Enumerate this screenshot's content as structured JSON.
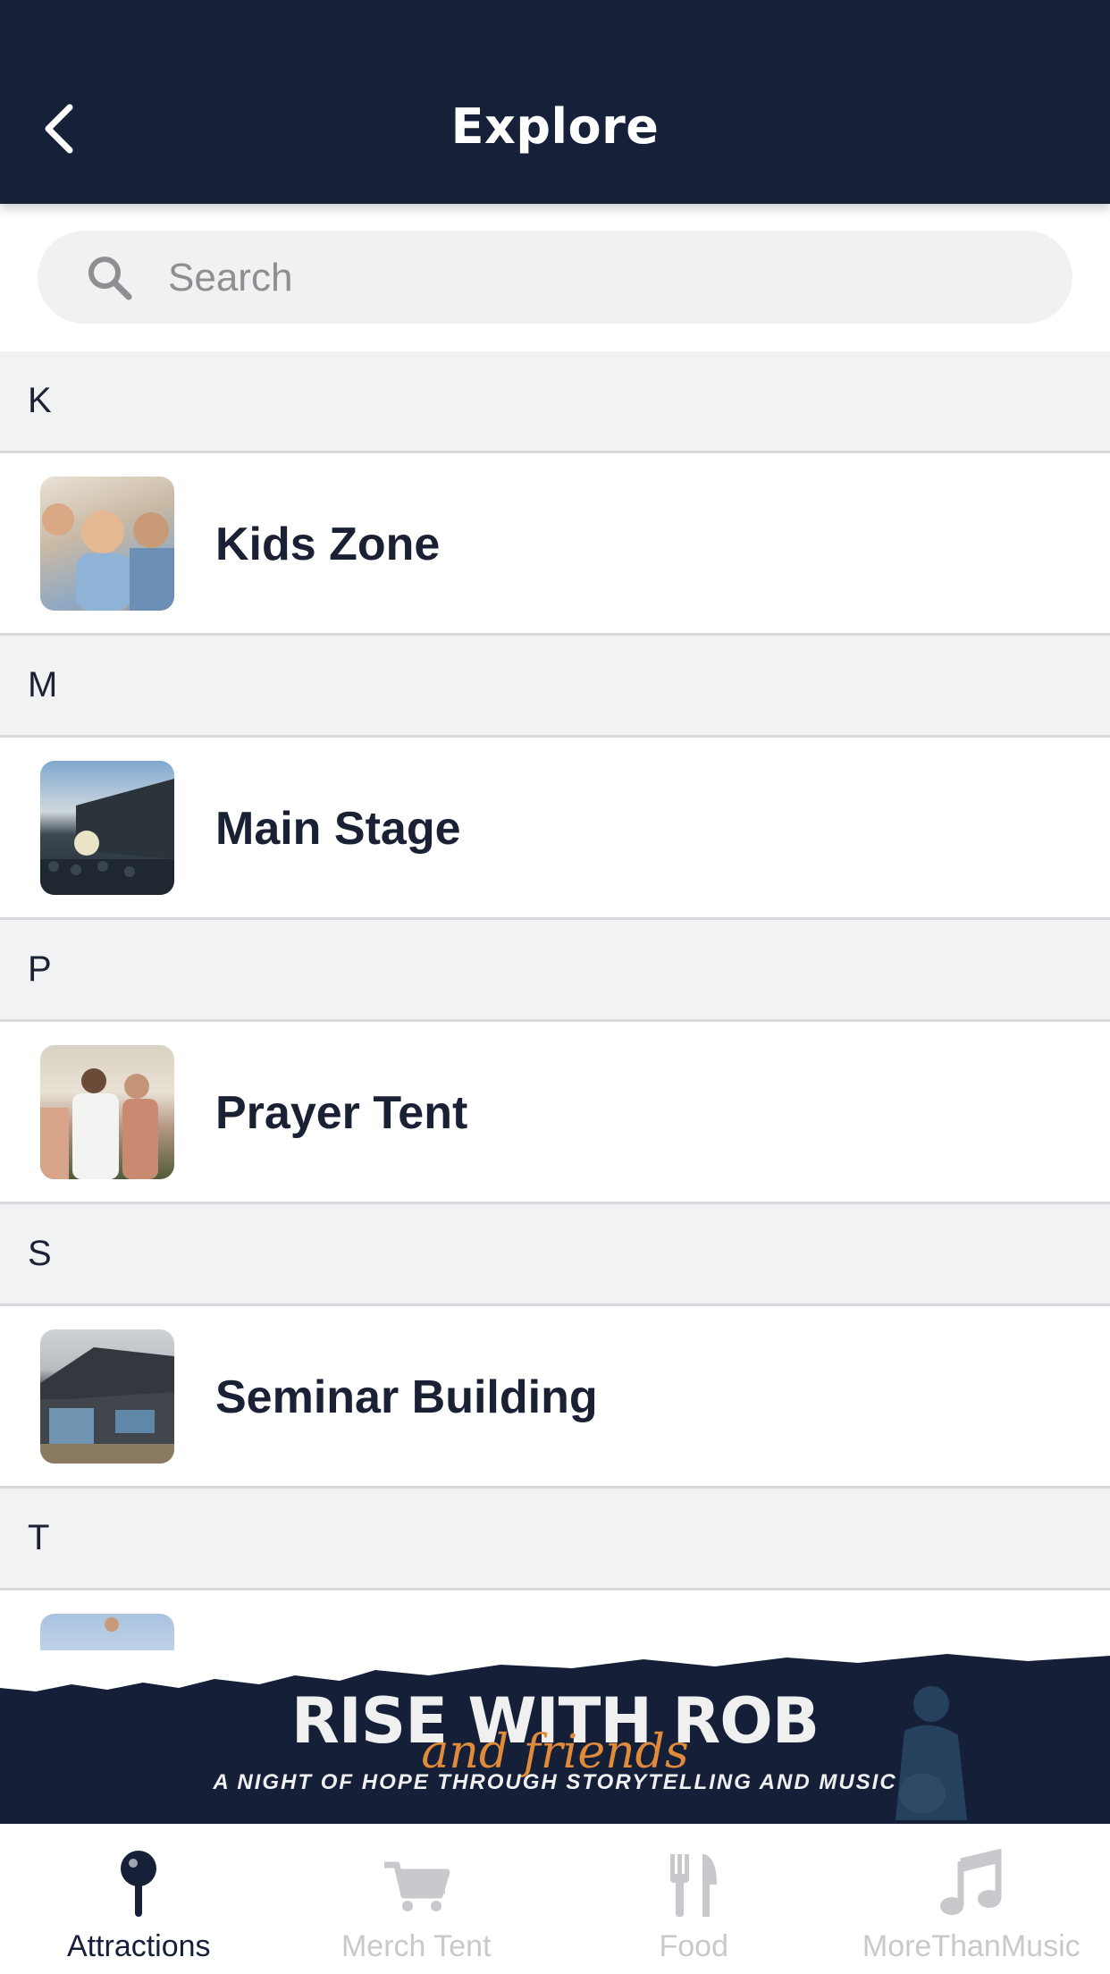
{
  "header": {
    "title": "Explore",
    "back_icon": "chevron-left-icon"
  },
  "search": {
    "placeholder": "Search",
    "icon": "search-icon"
  },
  "sections": [
    {
      "letter": "K",
      "items": [
        {
          "label": "Kids Zone"
        }
      ]
    },
    {
      "letter": "M",
      "items": [
        {
          "label": "Main Stage"
        }
      ]
    },
    {
      "letter": "P",
      "items": [
        {
          "label": "Prayer Tent"
        }
      ]
    },
    {
      "letter": "S",
      "items": [
        {
          "label": "Seminar Building"
        }
      ]
    },
    {
      "letter": "T",
      "items": [
        {
          "label": ""
        }
      ]
    }
  ],
  "banner": {
    "title": "RISE WITH ROB",
    "script": "and friends",
    "subtitle": "A NIGHT OF HOPE THROUGH STORYTELLING AND MUSIC"
  },
  "tabs": [
    {
      "label": "Attractions",
      "icon": "map-pin-icon",
      "active": true
    },
    {
      "label": "Merch Tent",
      "icon": "cart-icon",
      "active": false
    },
    {
      "label": "Food",
      "icon": "fork-knife-icon",
      "active": false
    },
    {
      "label": "MoreThanMusic",
      "icon": "music-note-icon",
      "active": false
    }
  ],
  "colors": {
    "header_bg": "#172039",
    "section_bg": "#f1f2f4",
    "active_tab": "#172039",
    "inactive_tab": "#c9c9cd",
    "banner_accent": "#e08a3a"
  }
}
